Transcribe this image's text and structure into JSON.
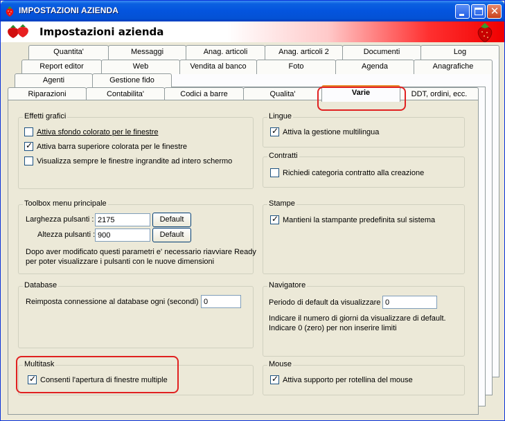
{
  "window": {
    "title": "IMPOSTAZIONI AZIENDA",
    "header_title": "Impostazioni azienda",
    "icon": "strawberry-icon",
    "title_color": "#0454de"
  },
  "tabs": {
    "row1": [
      "Quantita'",
      "Messaggi",
      "Anag. articoli",
      "Anag. articoli 2",
      "Documenti",
      "Log"
    ],
    "row2": [
      "Report editor",
      "Web",
      "Vendita al banco",
      "Foto",
      "Agenda",
      "Anagrafiche"
    ],
    "row3": [
      "Agenti",
      "Gestione fido"
    ],
    "row4": [
      "Riparazioni",
      "Contabilita'",
      "Codici a barre",
      "Qualita'",
      "Varie",
      "DDT, ordini, ecc."
    ],
    "selected": "Varie"
  },
  "effetti": {
    "title": "Effetti grafici",
    "opt1": "Attiva sfondo colorato per le finestre",
    "opt2": "Attiva barra superiore colorata per le finestre",
    "opt3": "Visualizza sempre le finestre ingrandite ad intero schermo",
    "checked": [
      false,
      true,
      false
    ]
  },
  "lingue": {
    "title": "Lingue",
    "opt": "Attiva la gestione multilingua",
    "checked": true
  },
  "contratti": {
    "title": "Contratti",
    "opt": "Richiedi categoria contratto alla creazione",
    "checked": false
  },
  "toolbox": {
    "title": "Toolbox menu principale",
    "width_label": "Larghezza pulsanti :",
    "width_value": "2175",
    "height_label": "Altezza pulsanti :",
    "height_value": "900",
    "default_label": "Default",
    "note1": "Dopo aver modificato questi parametri e' necessario riavviare Ready",
    "note2": "per poter visualizzare i pulsanti con le nuove dimensioni"
  },
  "stampe": {
    "title": "Stampe",
    "opt": "Mantieni la stampante predefinita sul sistema",
    "checked": true
  },
  "database": {
    "title": "Database",
    "label": "Reimposta connessione al database ogni (secondi) :",
    "value": "0"
  },
  "navigatore": {
    "title": "Navigatore",
    "label": "Periodo di default da visualizzare :",
    "value": "0",
    "note1": "Indicare il numero di giorni da visualizzare di default.",
    "note2": "Indicare 0 (zero) per non inserire limiti"
  },
  "multitask": {
    "title": "Multitask",
    "opt": "Consenti l'apertura di finestre multiple",
    "checked": true
  },
  "mouse": {
    "title": "Mouse",
    "opt": "Attiva supporto per rotellina del mouse",
    "checked": true
  }
}
